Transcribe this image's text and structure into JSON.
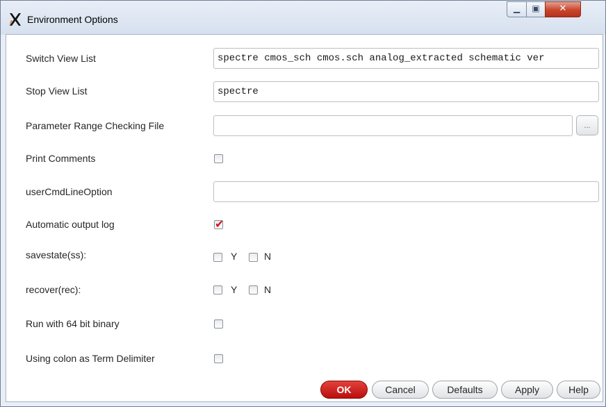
{
  "window": {
    "title": "Environment Options",
    "icons": {
      "app": "x-logo-icon",
      "minimize": "minimize-icon",
      "maximize": "maximize-icon",
      "close": "close-icon"
    }
  },
  "form": {
    "switch_view_list": {
      "label": "Switch View List",
      "value": "spectre cmos_sch cmos.sch analog_extracted schematic ver"
    },
    "stop_view_list": {
      "label": "Stop View List",
      "value": "spectre"
    },
    "param_range_file": {
      "label": "Parameter Range Checking File",
      "value": "",
      "browse_label": "..."
    },
    "print_comments": {
      "label": "Print Comments",
      "checked": false
    },
    "user_cmd_line_option": {
      "label": "userCmdLineOption",
      "value": ""
    },
    "automatic_output_log": {
      "label": "Automatic output log",
      "checked": true
    },
    "savestate": {
      "label": "savestate(ss):",
      "y_label": "Y",
      "n_label": "N",
      "y_checked": false,
      "n_checked": false
    },
    "recover": {
      "label": "recover(rec):",
      "y_label": "Y",
      "n_label": "N",
      "y_checked": false,
      "n_checked": false
    },
    "run_64bit": {
      "label": "Run with 64 bit binary",
      "checked": false
    },
    "colon_term_delimiter": {
      "label": "Using colon as Term Delimiter",
      "checked": false
    }
  },
  "buttons": {
    "ok": "OK",
    "cancel": "Cancel",
    "defaults": "Defaults",
    "apply": "Apply",
    "help": "Help"
  },
  "colors": {
    "ok_button": "#c8161a",
    "checkmark": "#d0161b",
    "close_button": "#c8452b"
  }
}
